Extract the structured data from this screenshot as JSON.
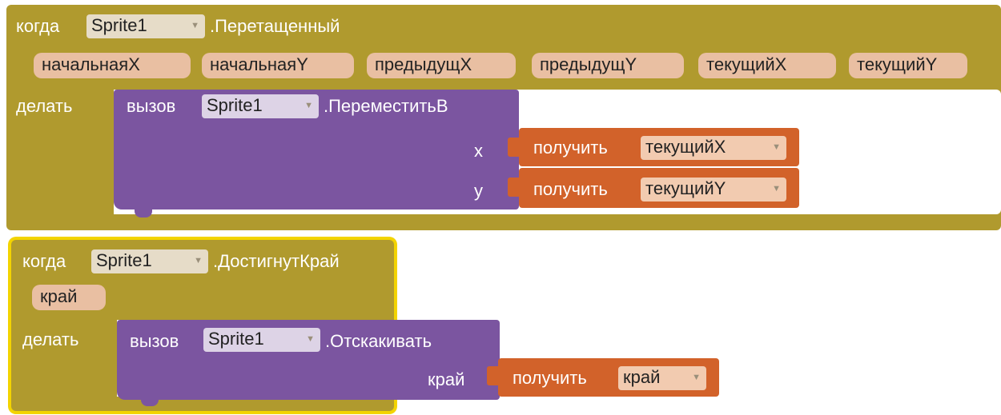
{
  "event1": {
    "when": "когда",
    "component": "Sprite1",
    "event": ".Перетащенный",
    "params": [
      "начальнаяX",
      "начальнаяY",
      "предыдущX",
      "предыдущY",
      "текущийX",
      "текущийY"
    ],
    "do": "делать",
    "call": "вызов",
    "call_component": "Sprite1",
    "method": ".ПереместитьВ",
    "arg_x_label": "x",
    "arg_y_label": "y",
    "get_label": "получить",
    "get_x_var": "текущийX",
    "get_y_var": "текущийY"
  },
  "event2": {
    "when": "когда",
    "component": "Sprite1",
    "event": ".ДостигнутКрай",
    "params": [
      "край"
    ],
    "do": "делать",
    "call": "вызов",
    "call_component": "Sprite1",
    "method": ".Отскакивать",
    "arg_label": "край",
    "get_label": "получить",
    "get_var": "край"
  },
  "icons": {
    "dropdown": "chevron-down-icon"
  },
  "colors": {
    "event": "#b09a2e",
    "call": "#7b55a0",
    "get": "#d2622a",
    "selected": "#f3d400"
  }
}
